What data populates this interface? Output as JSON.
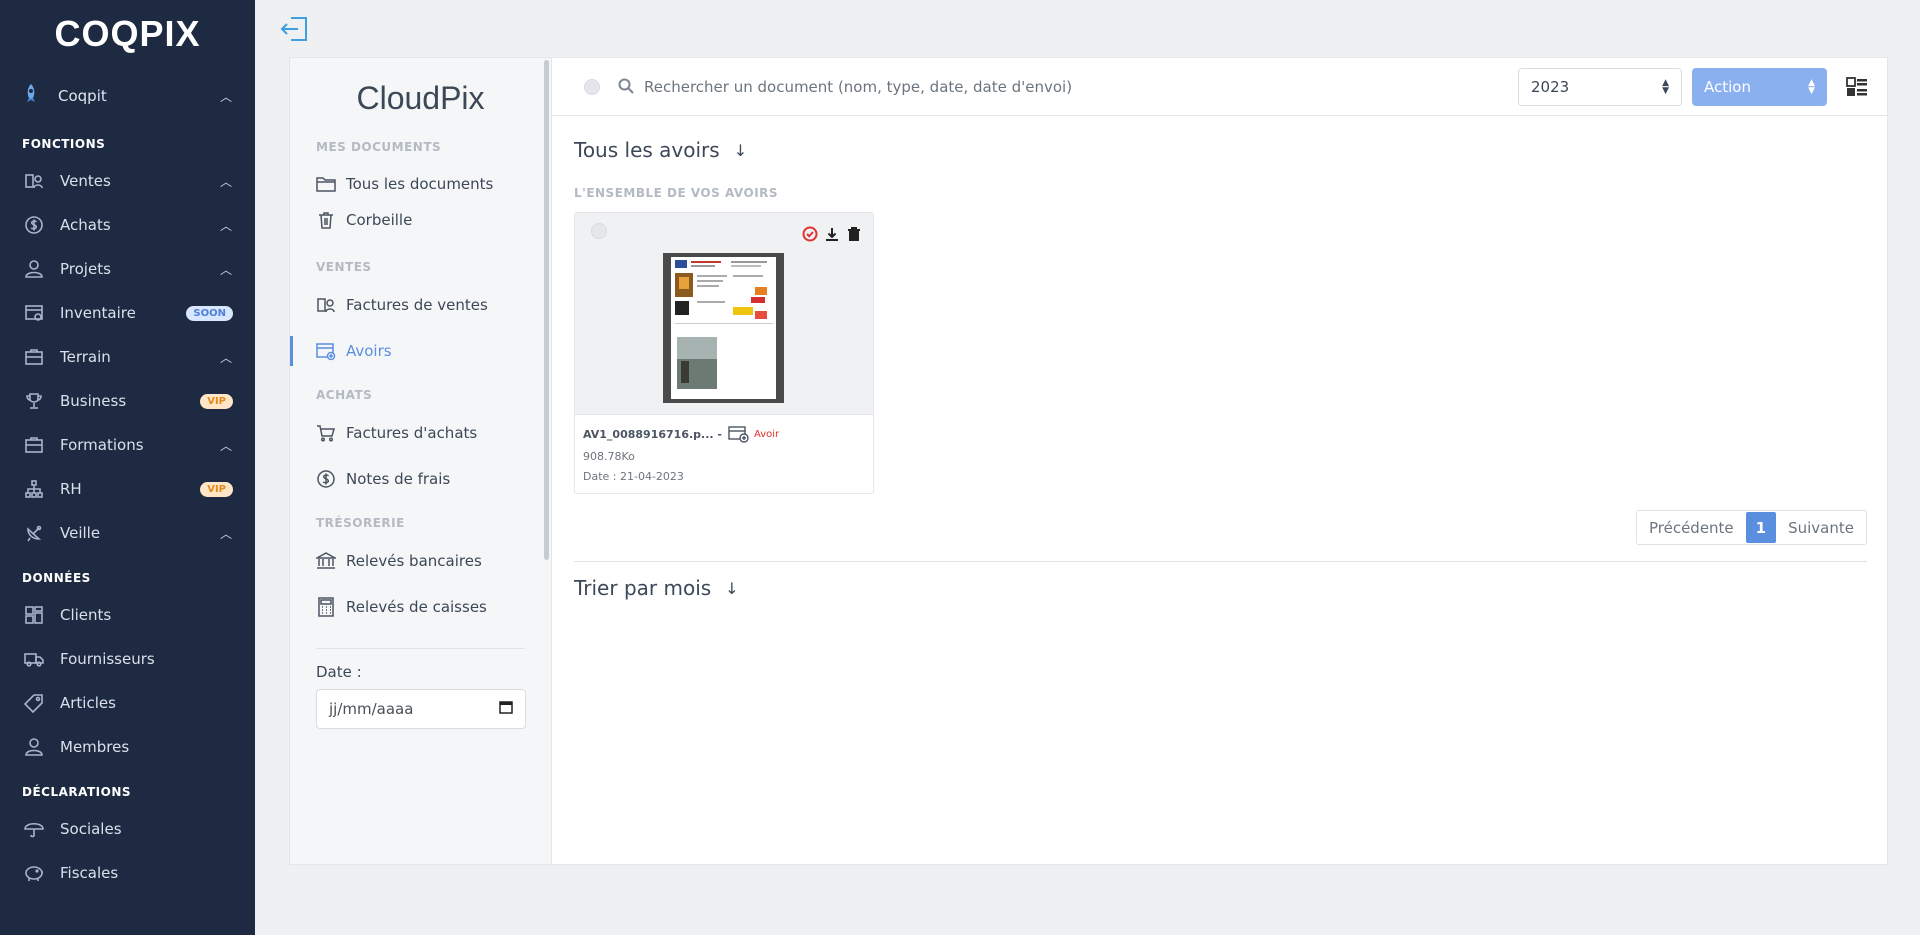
{
  "sidebar": {
    "logo": "COQPIX",
    "workspace": {
      "label": "Coqpit"
    },
    "sections": [
      {
        "title": "FONCTIONS",
        "items": [
          {
            "label": "Ventes",
            "icon": "sales-icon",
            "chevron": true
          },
          {
            "label": "Achats",
            "icon": "dollar-circle-icon",
            "chevron": true
          },
          {
            "label": "Projets",
            "icon": "user-icon",
            "chevron": true
          },
          {
            "label": "Inventaire",
            "icon": "inventory-icon",
            "badge": "SOON",
            "badge_type": "soon"
          },
          {
            "label": "Terrain",
            "icon": "briefcase-icon",
            "chevron": true
          },
          {
            "label": "Business",
            "icon": "trophy-icon",
            "badge": "VIP",
            "badge_type": "vip"
          },
          {
            "label": "Formations",
            "icon": "briefcase-icon",
            "chevron": true
          },
          {
            "label": "RH",
            "icon": "org-chart-icon",
            "badge": "VIP",
            "badge_type": "vip"
          },
          {
            "label": "Veille",
            "icon": "satellite-icon",
            "chevron": true
          }
        ]
      },
      {
        "title": "DONNÉES",
        "items": [
          {
            "label": "Clients",
            "icon": "layout-icon"
          },
          {
            "label": "Fournisseurs",
            "icon": "truck-icon"
          },
          {
            "label": "Articles",
            "icon": "tag-icon"
          },
          {
            "label": "Membres",
            "icon": "user-icon"
          }
        ]
      },
      {
        "title": "DÉCLARATIONS",
        "items": [
          {
            "label": "Sociales",
            "icon": "umbrella-icon"
          },
          {
            "label": "Fiscales",
            "icon": "piggy-bank-icon"
          }
        ]
      }
    ]
  },
  "docnav": {
    "brand": "CloudPix",
    "sections": [
      {
        "title": "MES DOCUMENTS",
        "items": [
          {
            "label": "Tous les documents",
            "icon": "folder-icon"
          },
          {
            "label": "Corbeille",
            "icon": "trash-icon"
          }
        ]
      },
      {
        "title": "VENTES",
        "items": [
          {
            "label": "Factures de ventes",
            "icon": "sales-icon"
          },
          {
            "label": "Avoirs",
            "icon": "credit-note-icon",
            "active": true
          }
        ]
      },
      {
        "title": "ACHATS",
        "items": [
          {
            "label": "Factures d'achats",
            "icon": "cart-icon"
          },
          {
            "label": "Notes de frais",
            "icon": "dollar-circle-icon"
          }
        ]
      },
      {
        "title": "TRÉSORERIE",
        "items": [
          {
            "label": "Relevés bancaires",
            "icon": "bank-icon"
          },
          {
            "label": "Relevés de caisses",
            "icon": "calculator-icon"
          }
        ]
      }
    ],
    "date_label": "Date :",
    "date_placeholder": "jj/mm/aaaa"
  },
  "toolbar": {
    "search_placeholder": "Rechercher un document (nom, type, date, date d'envoi)",
    "year": "2023",
    "action": "Action"
  },
  "main": {
    "heading": "Tous les avoirs",
    "subheading": "L'ENSEMBLE DE VOS AVOIRS",
    "documents": [
      {
        "name": "AV1_0088916716.p... -",
        "type": "Avoir",
        "size": "908.78Ko",
        "date": "Date : 21-04-2023"
      }
    ],
    "pagination": {
      "prev": "Précédente",
      "current": "1",
      "next": "Suivante"
    },
    "sort_heading": "Trier par mois"
  },
  "colors": {
    "sidebar_bg": "#1e2a42",
    "accent": "#5a8fe0",
    "action_button": "#8ab0f0",
    "danger": "#e03131"
  }
}
